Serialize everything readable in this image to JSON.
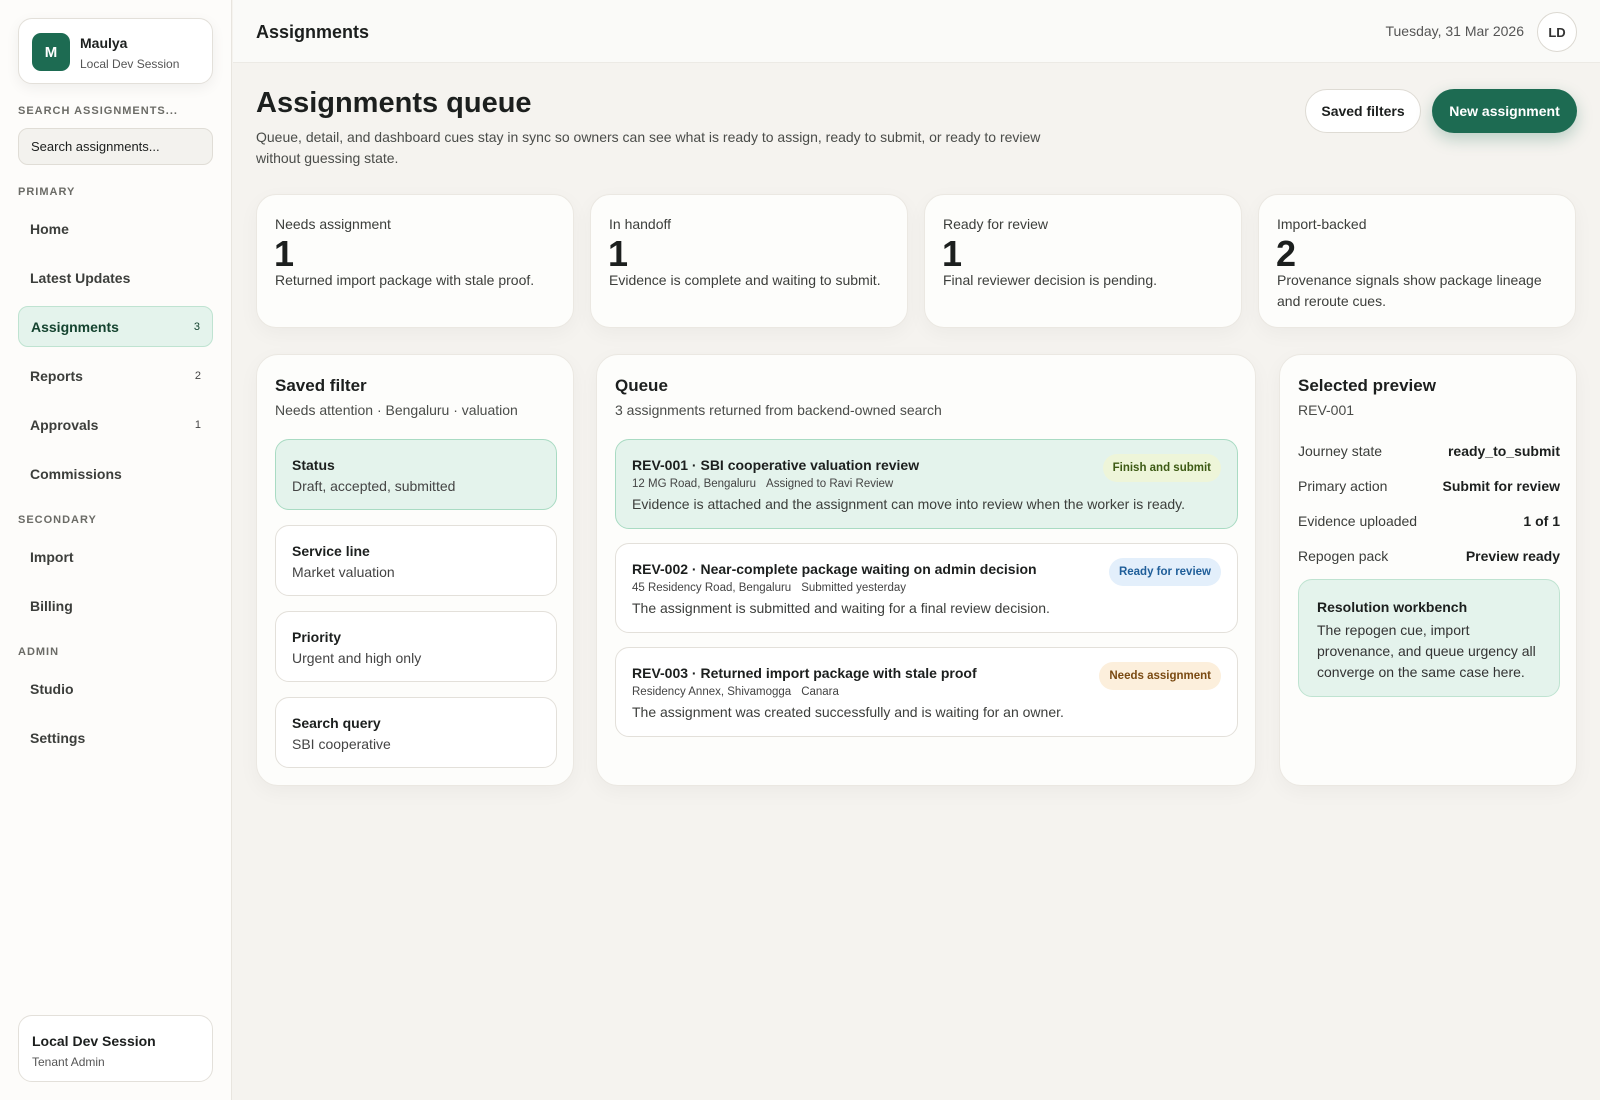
{
  "profile": {
    "initial": "M",
    "name": "Maulya",
    "session": "Local Dev Session"
  },
  "search": {
    "label": "SEARCH ASSIGNMENTS...",
    "placeholder": "Search assignments..."
  },
  "nav": {
    "primary_label": "PRIMARY",
    "secondary_label": "SECONDARY",
    "admin_label": "ADMIN",
    "primary": [
      {
        "label": "Home",
        "count": ""
      },
      {
        "label": "Latest Updates",
        "count": ""
      },
      {
        "label": "Assignments",
        "count": "3"
      },
      {
        "label": "Reports",
        "count": "2"
      },
      {
        "label": "Approvals",
        "count": "1"
      },
      {
        "label": "Commissions",
        "count": ""
      }
    ],
    "secondary": [
      {
        "label": "Import"
      },
      {
        "label": "Billing"
      }
    ],
    "admin": [
      {
        "label": "Studio"
      },
      {
        "label": "Settings"
      }
    ]
  },
  "session_card": {
    "title": "Local Dev Session",
    "role": "Tenant Admin"
  },
  "topbar": {
    "title": "Assignments",
    "date": "Tuesday, 31 Mar 2026",
    "avatar": "LD"
  },
  "header": {
    "title": "Assignments queue",
    "description": "Queue, detail, and dashboard cues stay in sync so owners can see what is ready to assign, ready to submit, or ready to review without guessing state.",
    "saved_filters_label": "Saved filters",
    "new_assignment_label": "New assignment"
  },
  "stats": [
    {
      "label": "Needs assignment",
      "value": "1",
      "desc": "Returned import package with stale proof."
    },
    {
      "label": "In handoff",
      "value": "1",
      "desc": "Evidence is complete and waiting to submit."
    },
    {
      "label": "Ready for review",
      "value": "1",
      "desc": "Final reviewer decision is pending."
    },
    {
      "label": "Import-backed",
      "value": "2",
      "desc": "Provenance signals show package lineage and reroute cues."
    }
  ],
  "saved_filter": {
    "title": "Saved filter",
    "subtitle": "Needs attention · Bengaluru · valuation",
    "items": [
      {
        "name": "Status",
        "value": "Draft, accepted, submitted"
      },
      {
        "name": "Service line",
        "value": "Market valuation"
      },
      {
        "name": "Priority",
        "value": "Urgent and high only"
      },
      {
        "name": "Search query",
        "value": "SBI cooperative"
      }
    ]
  },
  "queue": {
    "title": "Queue",
    "subtitle": "3 assignments returned from backend-owned search",
    "items": [
      {
        "title": "REV-001 · SBI cooperative valuation review",
        "location": "12 MG Road, Bengaluru",
        "meta": "Assigned to Ravi Review",
        "desc": "Evidence is attached and the assignment can move into review when the worker is ready.",
        "badge": "Finish and submit",
        "badge_bg": "#eef5d9",
        "badge_fg": "#3d5a14"
      },
      {
        "title": "REV-002 · Near-complete package waiting on admin decision",
        "location": "45 Residency Road, Bengaluru",
        "meta": "Submitted yesterday",
        "desc": "The assignment is submitted and waiting for a final review decision.",
        "badge": "Ready for review",
        "badge_bg": "#e3effb",
        "badge_fg": "#1f5e99"
      },
      {
        "title": "REV-003 · Returned import package with stale proof",
        "location": "Residency Annex, Shivamogga",
        "meta": "Canara",
        "desc": "The assignment was created successfully and is waiting for an owner.",
        "badge": "Needs assignment",
        "badge_bg": "#fcefdc",
        "badge_fg": "#7a4a12"
      }
    ]
  },
  "preview": {
    "title": "Selected preview",
    "id": "REV-001",
    "rows": [
      {
        "key": "Journey state",
        "value": "ready_to_submit"
      },
      {
        "key": "Primary action",
        "value": "Submit for review"
      },
      {
        "key": "Evidence uploaded",
        "value": "1 of 1"
      },
      {
        "key": "Repogen pack",
        "value": "Preview ready"
      }
    ],
    "workbench_title": "Resolution workbench",
    "workbench_text": "The repogen cue, import provenance, and queue urgency all converge on the same case here."
  }
}
